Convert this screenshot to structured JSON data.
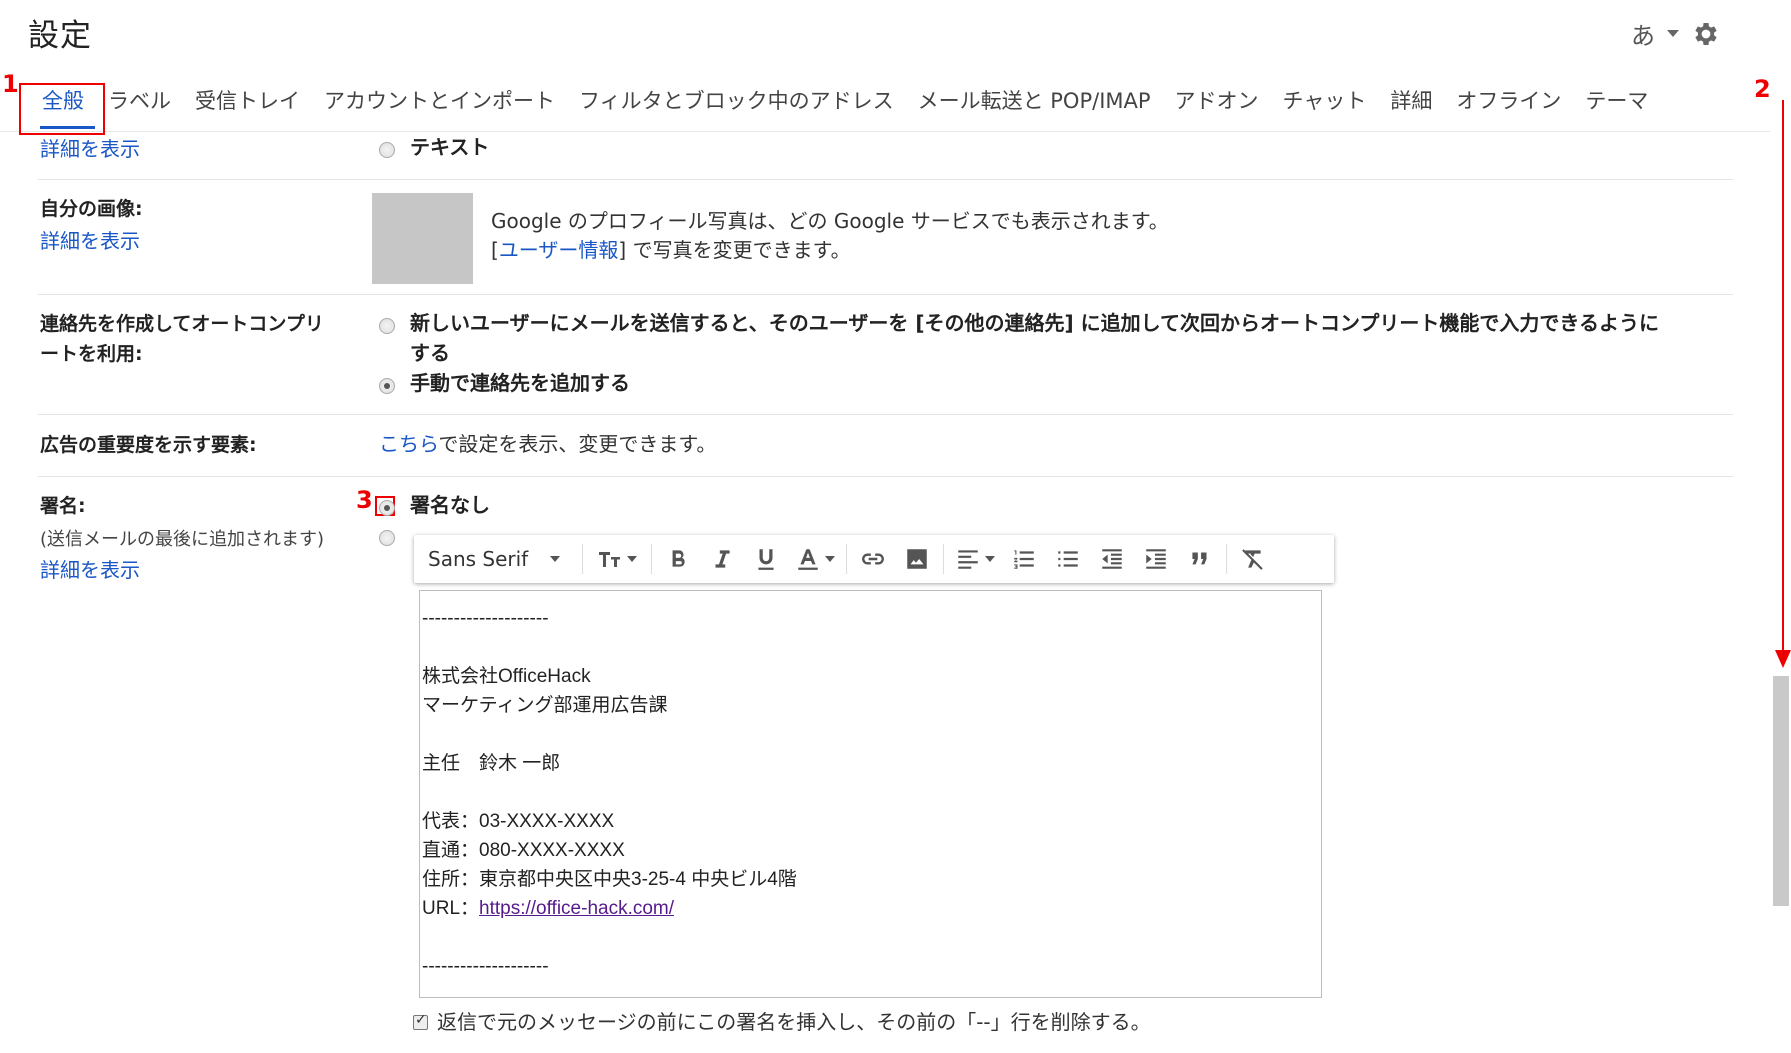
{
  "header": {
    "title": "設定",
    "ime_label": "あ",
    "icons": [
      "chevron-down-icon",
      "gear-icon"
    ]
  },
  "tabs": [
    {
      "label": "全般",
      "active": true
    },
    {
      "label": "ラベル"
    },
    {
      "label": "受信トレイ"
    },
    {
      "label": "アカウントとインポート"
    },
    {
      "label": "フィルタとブロック中のアドレス"
    },
    {
      "label": "メール転送と POP/IMAP"
    },
    {
      "label": "アドオン"
    },
    {
      "label": "チャット"
    },
    {
      "label": "詳細"
    },
    {
      "label": "オフライン"
    },
    {
      "label": "テーマ"
    }
  ],
  "annotations": {
    "n1": "1",
    "n2": "2",
    "n3": "3"
  },
  "rows": {
    "text_option": {
      "link": "詳細を表示",
      "radio_label": "テキスト"
    },
    "picture": {
      "label": "自分の画像:",
      "link": "詳細を表示",
      "line1": "Google のプロフィール写真は、どの Google サービスでも表示されます。",
      "line2_prefix": "[",
      "line2_link": "ユーザー情報",
      "line2_suffix": "] で写真を変更できます。"
    },
    "autocomplete": {
      "label_line1": "連絡先を作成してオートコンプリ",
      "label_line2": "ートを利用:",
      "option1_line1": "新しいユーザーにメールを送信すると、そのユーザーを [その他の連絡先] に追加して次回からオートコンプリート機能で入力できるように",
      "option1_line2": "する",
      "option2": "手動で連絡先を追加する"
    },
    "ads": {
      "label": "広告の重要度を示す要素:",
      "link": "こちら",
      "text": "で設定を表示、変更できます。"
    },
    "signature": {
      "label": "署名:",
      "sub": "(送信メールの最後に追加されます)",
      "link": "詳細を表示",
      "no_signature": "署名なし",
      "selected": "no_signature",
      "font_select": "Sans Serif",
      "lines": [
        "--------------------",
        "",
        "株式会社OfficeHack",
        "マーケティング部運用広告課",
        "",
        "主任　鈴木 一郎",
        "",
        "代表：03-XXXX-XXXX",
        "直通：080-XXXX-XXXX",
        "住所：東京都中央区中央3-25-4 中央ビル4階"
      ],
      "url_prefix": "URL：",
      "url": "https://office-hack.com/",
      "end_line": "--------------------",
      "checkbox_label": "返信で元のメッセージの前にこの署名を挿入し、その前の「--」行を削除する。",
      "checkbox_checked": true
    }
  }
}
